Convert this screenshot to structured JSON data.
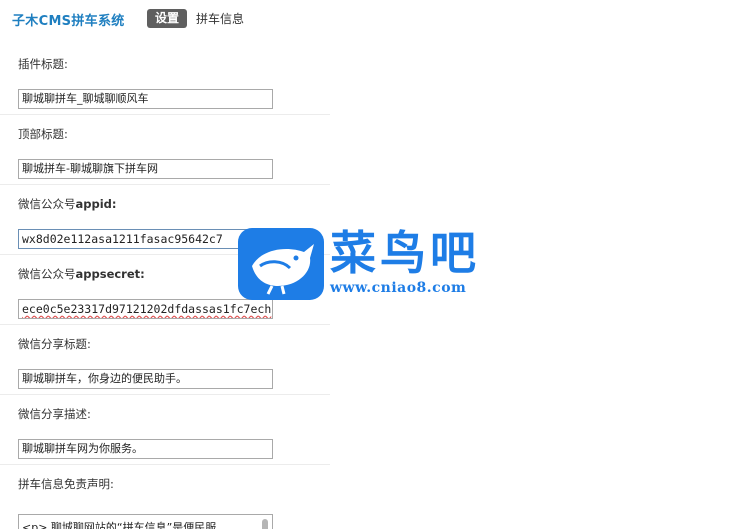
{
  "header": {
    "app_title": "子木CMS拼车系统",
    "tabs": [
      {
        "label": "设置",
        "active": true
      },
      {
        "label": "拼车信息",
        "active": false
      }
    ]
  },
  "form": {
    "fields": [
      {
        "label": "插件标题:",
        "value": "聊城聊拼车_聊城聊顺风车"
      },
      {
        "label": "顶部标题:",
        "value": "聊城拼车-聊城聊旗下拼车网"
      },
      {
        "label_prefix": "微信公众号",
        "label_strong": "appid:",
        "value": "wx8d02e112asa1211fasac95642c7"
      },
      {
        "label_prefix": "微信公众号",
        "label_strong": "appsecret:",
        "value": "ece0c5e23317d97121202dfdassas1fc7ech"
      },
      {
        "label": "微信分享标题:",
        "value": "聊城聊拼车，你身边的便民助手。"
      },
      {
        "label": "微信分享描述:",
        "value": "聊城聊拼车网为你服务。"
      },
      {
        "label": "拼车信息免责声明:",
        "value": "<p>  聊城聊网站的“拼车信息”是便民服"
      }
    ]
  },
  "watermark": {
    "brand": "菜鸟吧",
    "url": "www.cniao8.com",
    "color": "#1e7de6"
  },
  "colors": {
    "accent": "#1f7fc0",
    "tab_active_bg": "#5f5f5f"
  }
}
